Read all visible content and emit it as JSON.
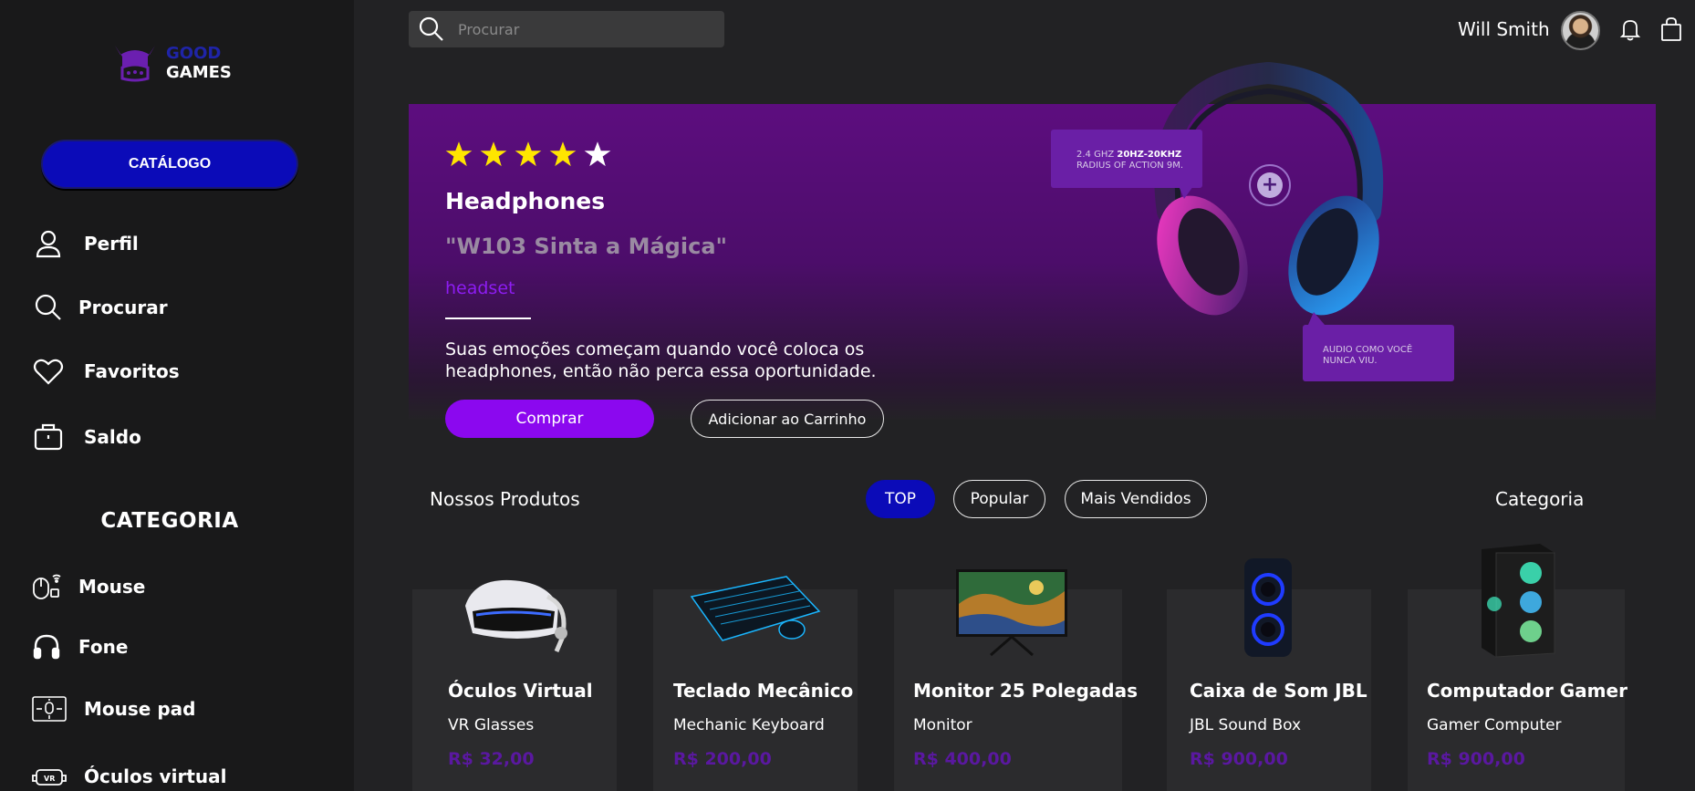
{
  "brand": {
    "line1": "GOOD",
    "line2": "GAMES"
  },
  "sidebar": {
    "catalog_label": "CATÁLOGO",
    "nav": [
      {
        "label": "Perfil",
        "icon": "user-icon"
      },
      {
        "label": "Procurar",
        "icon": "search-icon"
      },
      {
        "label": "Favoritos",
        "icon": "heart-icon"
      },
      {
        "label": "Saldo",
        "icon": "wallet-icon"
      }
    ],
    "category_heading": "CATEGORIA",
    "categories": [
      {
        "label": "Mouse",
        "icon": "mouse-icon"
      },
      {
        "label": "Fone",
        "icon": "headphone-icon"
      },
      {
        "label": "Mouse pad",
        "icon": "mousepad-icon"
      },
      {
        "label": "Óculos virtual",
        "icon": "vr-icon"
      }
    ]
  },
  "topbar": {
    "search_placeholder": "Procurar",
    "user_name": "Will Smith"
  },
  "hero": {
    "rating": 4,
    "rating_max": 5,
    "title": "Headphones",
    "subtitle": "\"W103 Sinta a Mágica\"",
    "tag": "headset",
    "description": "Suas emoções começam quando você coloca os headphones, então não perca essa oportunidade.",
    "buy_label": "Comprar",
    "cart_label": "Adicionar ao Carrinho",
    "bubble1_prefix": "2.4 GHZ ",
    "bubble1_bold": "20HZ-20KHZ",
    "bubble1_line2": "RADIUS OF ACTION 9M.",
    "bubble2_text": "AUDIO COMO VOCÊ NUNCA VIU."
  },
  "products_section": {
    "title": "Nossos Produtos",
    "filters": [
      "TOP",
      "Popular",
      "Mais Vendidos"
    ],
    "active_filter": "TOP",
    "category_link": "Categoria"
  },
  "products": [
    {
      "name": "Óculos Virtual",
      "subtitle": "VR Glasses",
      "price": "R$ 32,00"
    },
    {
      "name": "Teclado Mecânico",
      "subtitle": "Mechanic Keyboard",
      "price": "R$ 200,00"
    },
    {
      "name": "Monitor 25 Polegadas",
      "subtitle": "Monitor",
      "price": "R$ 400,00"
    },
    {
      "name": "Caixa de Som JBL",
      "subtitle": "JBL Sound Box",
      "price": "R$ 900,00"
    },
    {
      "name": "Computador Gamer",
      "subtitle": "Gamer Computer",
      "price": "R$ 900,00"
    }
  ],
  "colors": {
    "accent_purple": "#8b08ef",
    "accent_blue": "#0b0bb8",
    "star_gold": "#ffe500",
    "price_purple": "#5a18a0"
  }
}
